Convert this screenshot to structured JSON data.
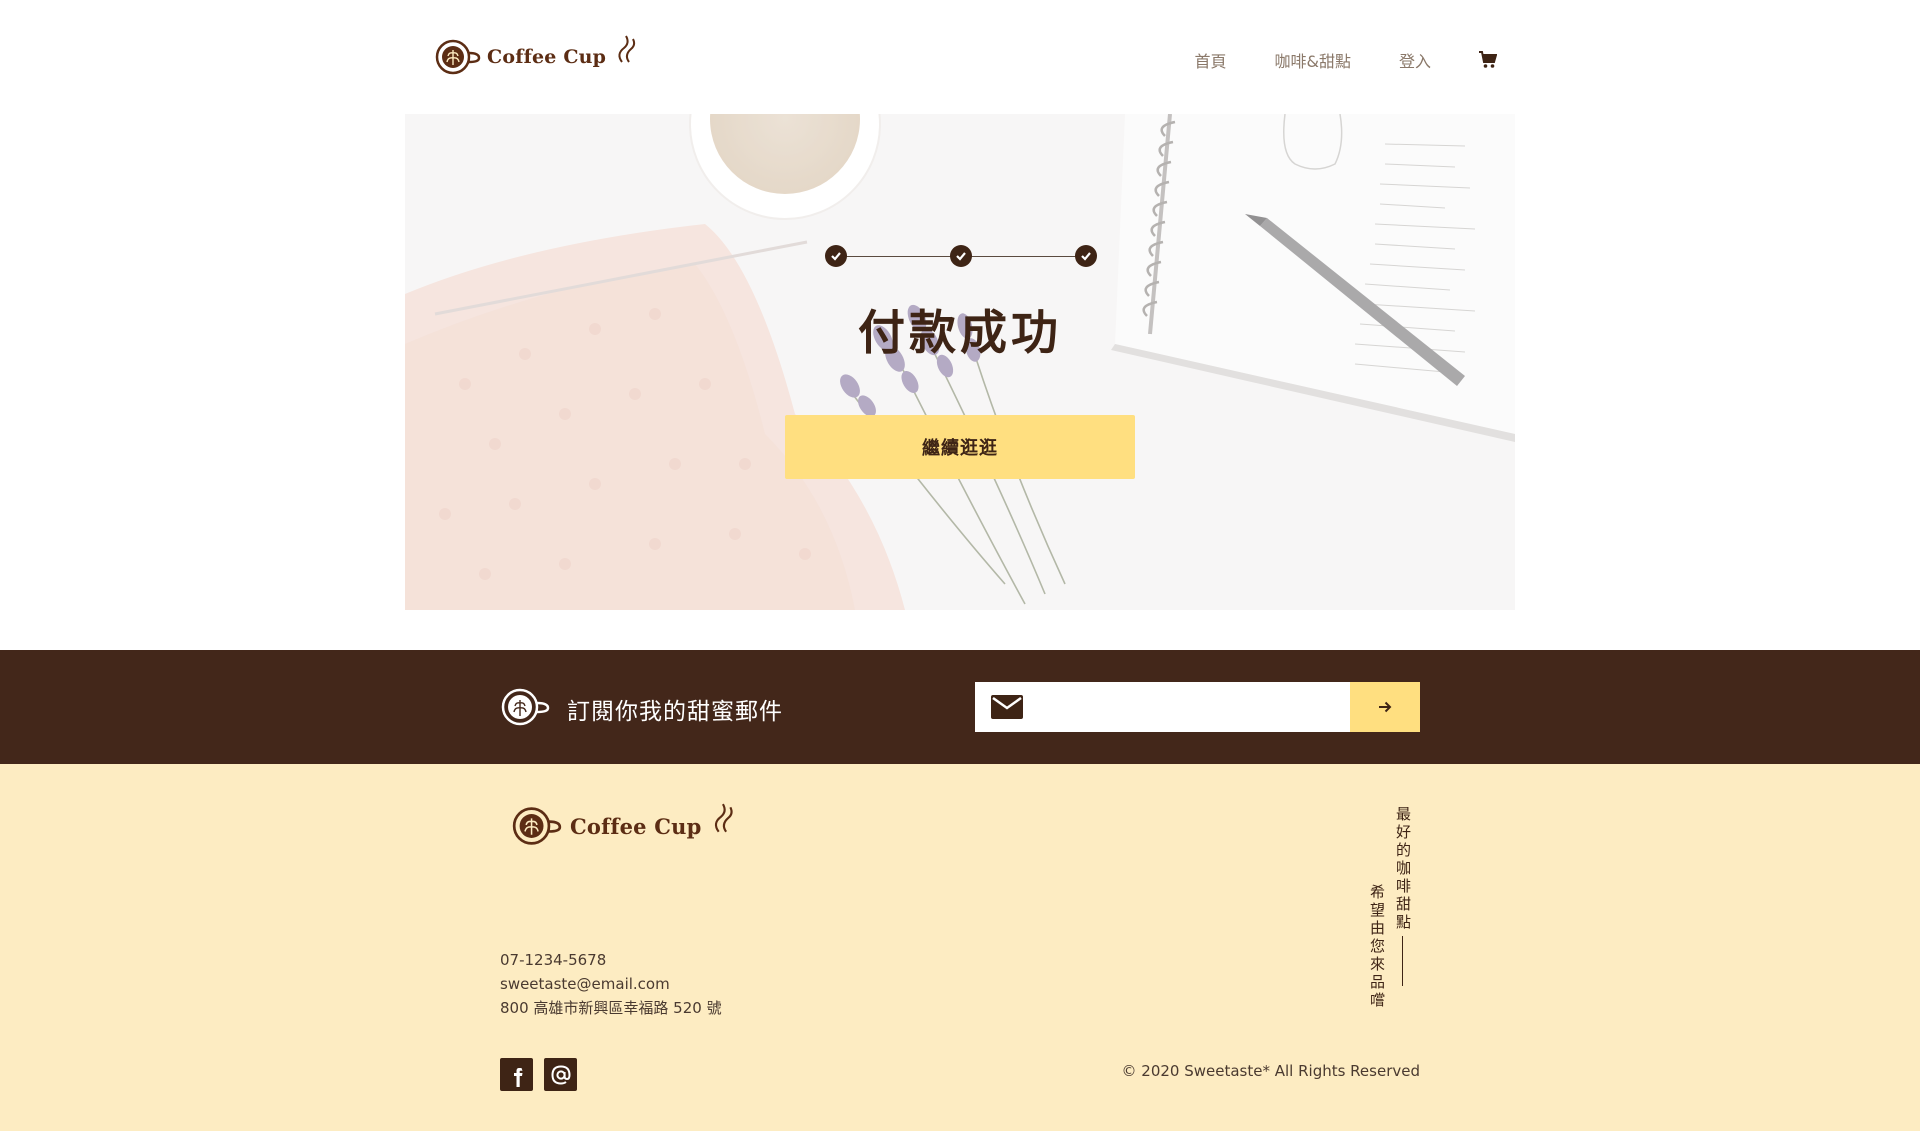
{
  "brand": {
    "name": "Coffee Cup"
  },
  "nav": {
    "items": [
      "首頁",
      "咖啡&甜點",
      "登入"
    ]
  },
  "hero": {
    "title": "付款成功",
    "continue_label": "繼續逛逛",
    "steps_completed": 3,
    "steps_total": 3
  },
  "subscribe": {
    "text": "訂閱你我的甜蜜郵件",
    "email_value": ""
  },
  "footer": {
    "brand": "Coffee Cup",
    "phone": "07-1234-5678",
    "email": "sweetaste@email.com",
    "address": "800 高雄市新興區幸福路 520 號",
    "tagline_col1": "最好的咖啡甜點",
    "tagline_col2": "希望由您來品嚐",
    "copyright": "© 2020 Sweetaste* All Rights Reserved",
    "social": [
      "facebook-icon",
      "at-sign-icon"
    ]
  },
  "colors": {
    "dark_brown": "#43271a",
    "accent_yellow": "#ffdf80",
    "footer_cream": "#fdecc2",
    "logo_brown": "#5c2d14"
  },
  "icons": {
    "logo": "latte-cup-icon",
    "steam": "steam-icon",
    "cart": "cart-icon",
    "step": "check-circle-icon",
    "mail": "envelope-icon",
    "submit": "arrow-right-icon"
  }
}
